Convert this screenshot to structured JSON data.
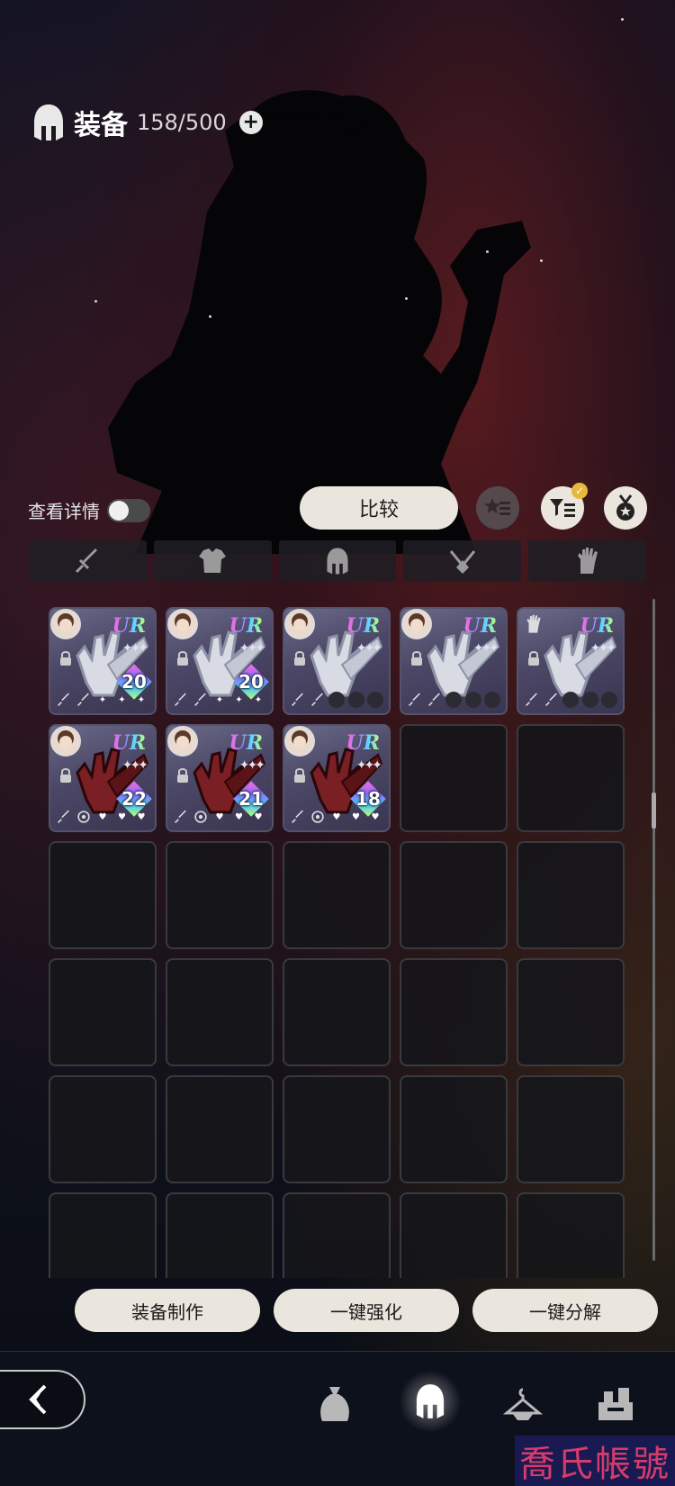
{
  "header": {
    "title": "装备",
    "count": "158/500",
    "add_label": "+"
  },
  "detail_toggle": {
    "label": "查看详情",
    "state": "off"
  },
  "compare_button": "比较",
  "tabs": [
    {
      "icon": "sword-icon"
    },
    {
      "icon": "armor-icon"
    },
    {
      "icon": "helmet-icon"
    },
    {
      "icon": "necklace-icon"
    },
    {
      "icon": "glove-icon"
    }
  ],
  "equipment": [
    {
      "rarity": "UR",
      "stars": "✦✦✦",
      "level": "20",
      "avatar": "portrait-pink-hair",
      "type": "silver-gauntlet"
    },
    {
      "rarity": "UR",
      "stars": "✦✦✦",
      "level": "20",
      "avatar": "portrait-brown-hair",
      "type": "silver-gauntlet"
    },
    {
      "rarity": "UR",
      "stars": "✦✦✦",
      "level": "",
      "avatar": "portrait-dark-hair",
      "type": "silver-gauntlet"
    },
    {
      "rarity": "UR",
      "stars": "✦✦✦",
      "level": "",
      "avatar": "portrait-blonde-hair",
      "type": "silver-gauntlet"
    },
    {
      "rarity": "UR",
      "stars": "✦✦✦",
      "level": "",
      "avatar": "glove-icon",
      "type": "silver-gauntlet"
    },
    {
      "rarity": "UR",
      "stars": "✦✦✦",
      "level": "22",
      "avatar": "portrait-white-hair",
      "type": "crimson-gauntlet"
    },
    {
      "rarity": "UR",
      "stars": "✦✦✦",
      "level": "21",
      "avatar": "portrait-black-hair",
      "type": "crimson-gauntlet"
    },
    {
      "rarity": "UR",
      "stars": "✦✦✦",
      "level": "18",
      "avatar": "portrait-maid",
      "type": "crimson-gauntlet"
    }
  ],
  "actions": {
    "craft": "装备制作",
    "enhance": "一键强化",
    "dismantle": "一键分解"
  },
  "nav": [
    {
      "icon": "bag-icon",
      "active": false
    },
    {
      "icon": "helmet-icon",
      "active": true
    },
    {
      "icon": "hanger-icon",
      "active": false
    },
    {
      "icon": "workshop-icon",
      "active": false
    }
  ],
  "watermark": "喬氏帳號",
  "colors": {
    "button_bg": "#ebe6dd",
    "badge": "#e7b83c",
    "watermark_bg": "#1a1a52",
    "watermark_text": "#d63c6a"
  }
}
